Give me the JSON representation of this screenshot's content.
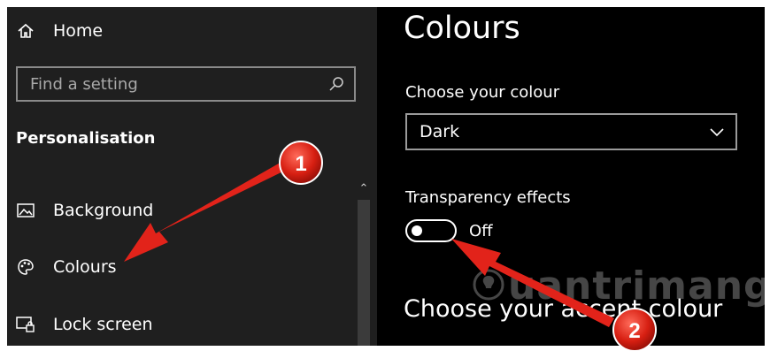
{
  "sidebar": {
    "home_label": "Home",
    "search_placeholder": "Find a setting",
    "section_title": "Personalisation",
    "items": [
      {
        "label": "Background",
        "icon": "image-icon"
      },
      {
        "label": "Colours",
        "icon": "palette-icon"
      },
      {
        "label": "Lock screen",
        "icon": "lock-screen-icon"
      }
    ]
  },
  "main": {
    "title": "Colours",
    "choose_colour_label": "Choose your colour",
    "choose_colour_value": "Dark",
    "transparency_label": "Transparency effects",
    "transparency_state": "Off",
    "accent_heading": "Choose your accent colour"
  },
  "annotations": {
    "badge_1": "1",
    "badge_2": "2",
    "arrow_color": "#e2231a"
  },
  "watermark": {
    "text": "uantrimang"
  },
  "colors": {
    "sidebar_bg": "#1f1f1f",
    "content_bg": "#000000",
    "text": "#ffffff",
    "annotation_red": "#e2231a"
  }
}
